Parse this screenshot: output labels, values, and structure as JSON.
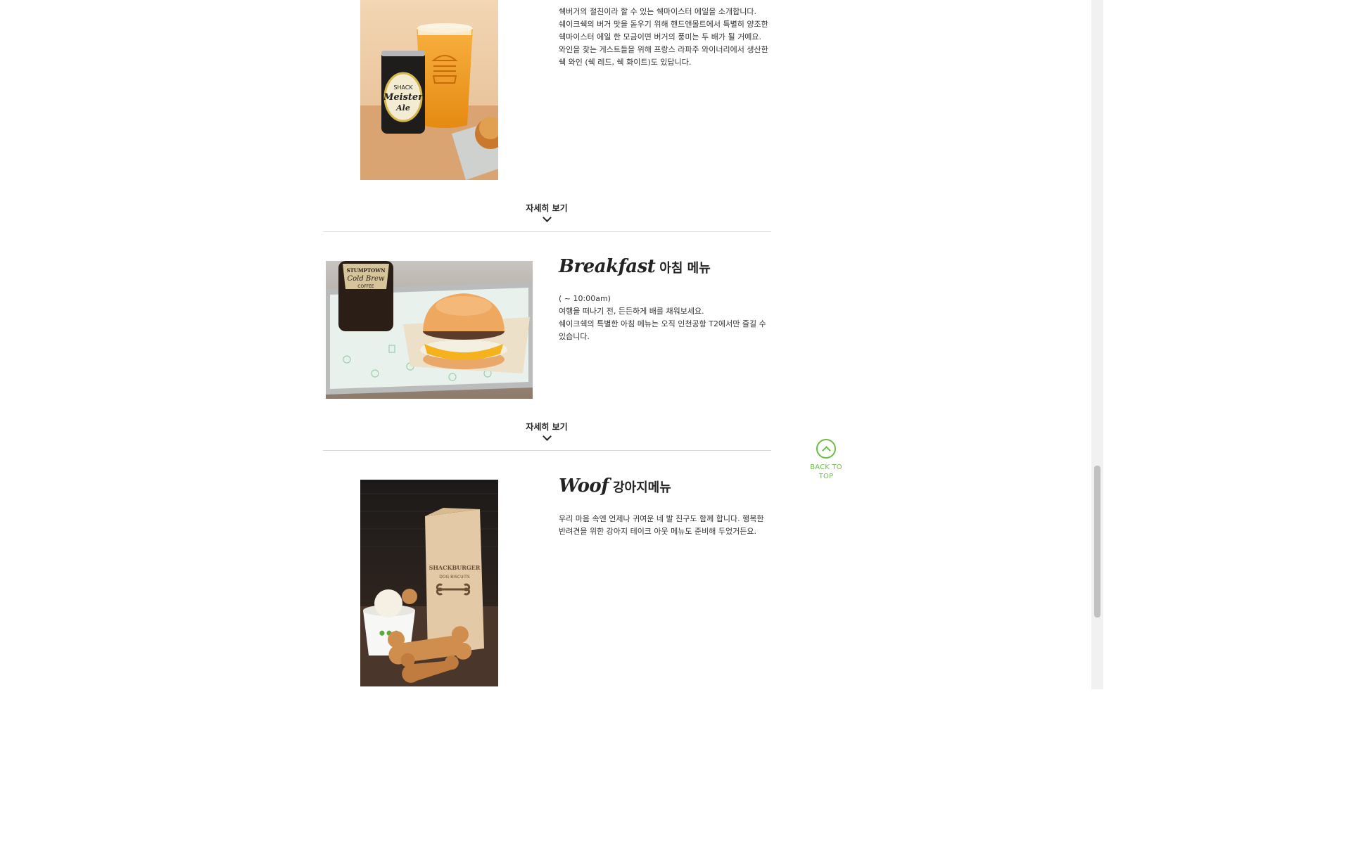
{
  "sections": [
    {
      "id": "beer",
      "description": [
        "쉑버거의 절친이라 할 수 있는 쉑마이스터 에일을 소개합니다.",
        "쉐이크쉑의 버거 맛을 돋우기 위해 핸드앤몰트에서 특별히 양조한 쉑마이스터 에일 한 모금이면 버거의 풍미는 두 배가 될 거예요.",
        "와인을 찾는 게스트들을 위해 프랑스 라파주 와이너리에서 생산한 쉑 와인 (쉑 레드, 쉑 화이트)도 있답니다."
      ],
      "image_alt": "Shack Meister Ale can and beer glass",
      "can_text": [
        "SHACK",
        "Meister",
        "Ale"
      ]
    },
    {
      "id": "breakfast",
      "title_en": "Breakfast",
      "title_ko": "아침 메뉴",
      "description": [
        "( ~ 10:00am)",
        "여행을 떠나기 전, 든든하게 배를 채워보세요.",
        "쉐이크쉑의 특별한 아침 메뉴는 오직 인천공항 T2에서만 즐길 수 있습니다."
      ],
      "image_alt": "Breakfast sandwich with Stumptown Cold Brew",
      "bottle_text": [
        "STUMPTOWN",
        "Cold Brew",
        "COFFEE"
      ]
    },
    {
      "id": "woof",
      "title_en": "Woof",
      "title_ko": "강아지메뉴",
      "description": [
        "우리 마음 속엔 언제나 귀여운 네 발 친구도 함께 합니다. 행복한 반려견을 위한 강아지 테이크 아웃 메뉴도 준비해 두었거든요."
      ],
      "image_alt": "ShackBurger dog biscuits bag and treats",
      "bag_text": [
        "SHACKBURGER",
        "DOG BISCUITS"
      ]
    }
  ],
  "more_label": "자세히 보기",
  "back_to_top": "BACK TO TOP",
  "colors": {
    "accent_green": "#6cbd45",
    "divider": "#d9d9d9"
  }
}
